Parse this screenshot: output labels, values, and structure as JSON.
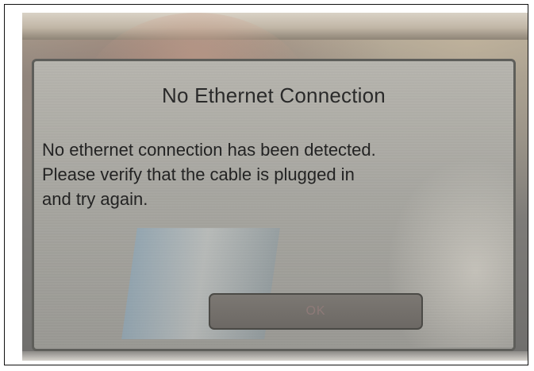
{
  "dialog": {
    "title": "No Ethernet Connection",
    "message": "No ethernet connection has been detected.\nPlease verify that the cable is plugged in\nand try again.",
    "ok_label": "OK"
  }
}
